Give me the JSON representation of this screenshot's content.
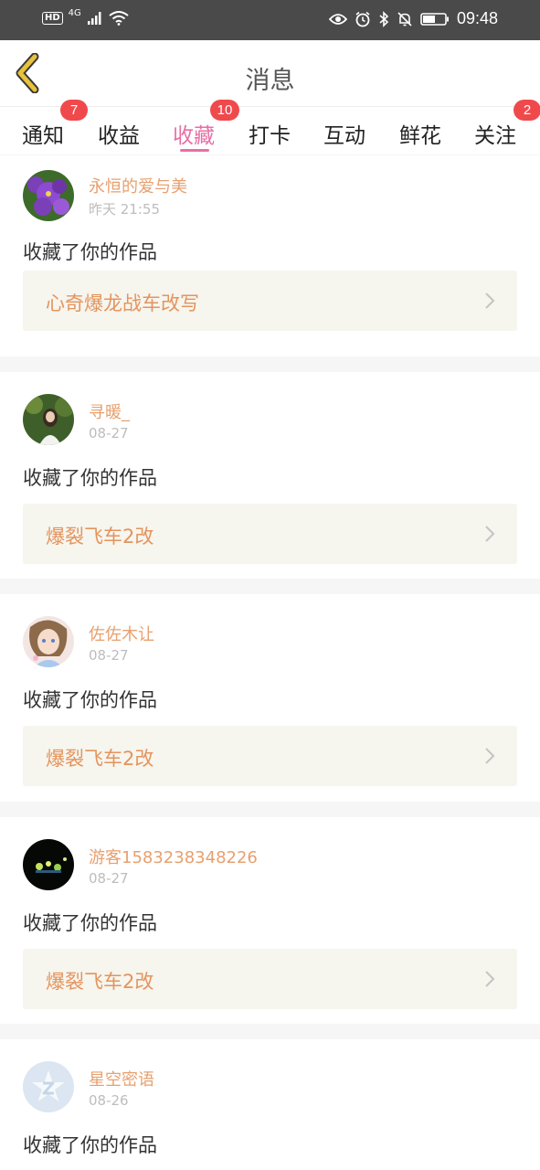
{
  "status_bar": {
    "network_label": "HD",
    "network_type": "4G",
    "time": "09:48"
  },
  "header": {
    "title": "消息"
  },
  "tabs": [
    {
      "label": "通知",
      "badge": "7"
    },
    {
      "label": "收益",
      "badge": ""
    },
    {
      "label": "收藏",
      "badge": "10",
      "active": true
    },
    {
      "label": "打卡",
      "badge": ""
    },
    {
      "label": "互动",
      "badge": ""
    },
    {
      "label": "鲜花",
      "badge": ""
    },
    {
      "label": "关注",
      "badge": "2"
    }
  ],
  "messages": [
    {
      "user": "永恒的爱与美",
      "time": "昨天 21:55",
      "action": "收藏了你的作品",
      "work": "心奇爆龙战车改写"
    },
    {
      "user": "寻暖_",
      "time": "08-27",
      "action": "收藏了你的作品",
      "work": "爆裂飞车2改"
    },
    {
      "user": "佐佐木让",
      "time": "08-27",
      "action": "收藏了你的作品",
      "work": "爆裂飞车2改"
    },
    {
      "user": "游客1583238348226",
      "time": "08-27",
      "action": "收藏了你的作品",
      "work": "爆裂飞车2改"
    },
    {
      "user": "星空密语",
      "time": "08-26",
      "action": "收藏了你的作品",
      "work": ""
    }
  ],
  "colors": {
    "accent_pink": "#e86fa6",
    "badge_red": "#f0494c",
    "username_orange": "#e7a06f",
    "work_title_orange": "#e4945d",
    "back_arrow_yellow": "#e8c23a"
  }
}
